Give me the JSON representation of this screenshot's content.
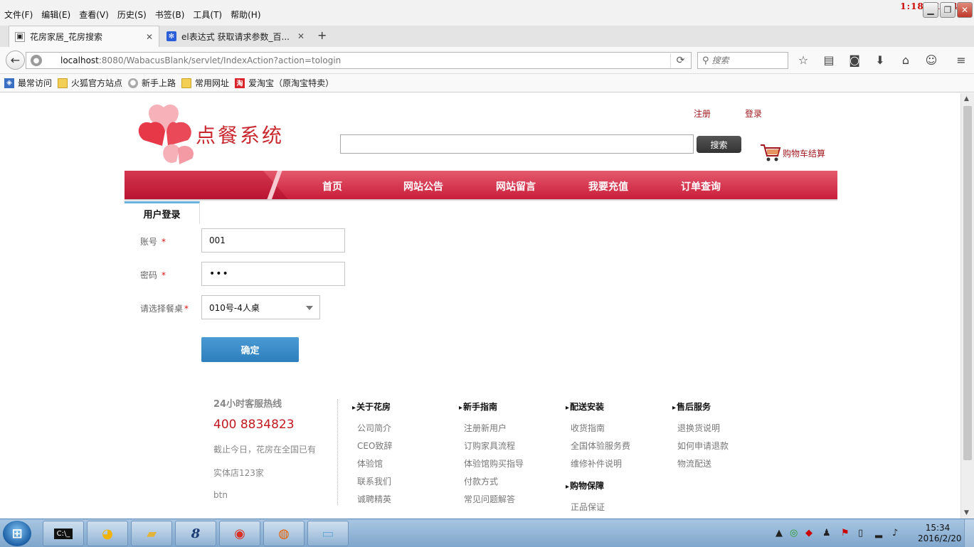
{
  "window": {
    "menus": [
      "文件(F)",
      "编辑(E)",
      "查看(V)",
      "历史(S)",
      "书签(B)",
      "工具(T)",
      "帮助(H)"
    ],
    "overlay_clock": "1:18/11:14"
  },
  "tabs": [
    {
      "title": "花房家居_花房搜索"
    },
    {
      "title": "el表达式 获取请求参数_百..."
    }
  ],
  "navbar": {
    "url_host": "localhost",
    "url_path": ":8080/WabacusBlank/servlet/IndexAction?action=tologin",
    "search_placeholder": "搜索"
  },
  "bookmarks": [
    "最常访问",
    "火狐官方站点",
    "新手上路",
    "常用网址",
    "爱淘宝（原淘宝特卖）"
  ],
  "site": {
    "logo_text": "点餐系统",
    "register": "注册",
    "login": "登录",
    "search_button": "搜索",
    "cart": "购物车结算",
    "nav": [
      "首页",
      "网站公告",
      "网站留言",
      "我要充值",
      "订单查询"
    ],
    "accent": "#c91d3a"
  },
  "login_form": {
    "tab_title": "用户登录",
    "account_label": "账号",
    "password_label": "密码",
    "table_label": "请选择餐桌",
    "required_mark": "*",
    "account_value": "001",
    "password_value": "•••",
    "table_value": "010号-4人桌",
    "confirm": "确定"
  },
  "footer": {
    "hotline_title": "24小时客服热线",
    "hotline_number": "400 8834823",
    "text1": "截止今日，花房在全国已有",
    "text2": "实体店123家",
    "text3": "btn",
    "columns": [
      {
        "title": "关于花房",
        "links": [
          "公司简介",
          "CEO致辞",
          "体验馆",
          "联系我们",
          "诚聘精英"
        ]
      },
      {
        "title": "新手指南",
        "links": [
          "注册新用户",
          "订购家具流程",
          "体验馆购买指导",
          "付款方式",
          "常见问题解答"
        ]
      },
      {
        "title": "配送安装",
        "links": [
          "收货指南",
          "全国体验服务费",
          "维修补件说明"
        ]
      },
      {
        "title": "售后服务",
        "links": [
          "退换货说明",
          "如何申请退款",
          "物流配送"
        ]
      }
    ],
    "extra_column": {
      "title": "购物保障",
      "links": [
        "正品保证"
      ]
    }
  },
  "taskbar": {
    "time": "15:34",
    "date": "2016/2/20"
  }
}
